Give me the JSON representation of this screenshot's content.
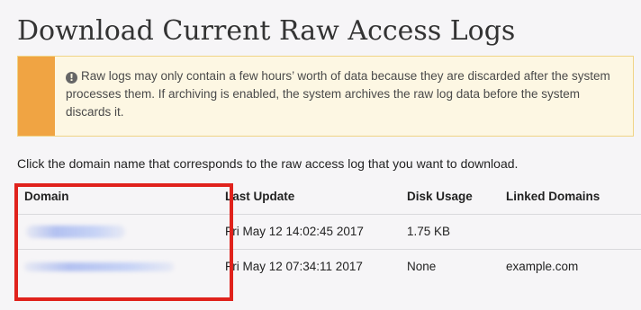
{
  "page": {
    "title": "Download Current Raw Access Logs"
  },
  "alert": {
    "icon": "exclamation-circle-icon",
    "icon_glyph": "!",
    "text": "Raw logs may only contain a few hours’ worth of data because they are discarded after the system processes them. If archiving is enabled, the system archives the raw log data before the system discards it.",
    "bar_color": "#f0a443"
  },
  "instructions": "Click the domain name that corresponds to the raw access log that you want to download.",
  "table": {
    "columns": [
      "Domain",
      "Last Update",
      "Disk Usage",
      "Linked Domains"
    ],
    "rows": [
      {
        "domain": "",
        "last_update": "Fri May 12 14:02:45 2017",
        "disk_usage": "1.75 KB",
        "linked_domains": ""
      },
      {
        "domain": "",
        "last_update": "Fri May 12 07:34:11 2017",
        "disk_usage": "None",
        "linked_domains": "example.com"
      }
    ]
  },
  "highlight": {
    "color": "#e0221c"
  }
}
